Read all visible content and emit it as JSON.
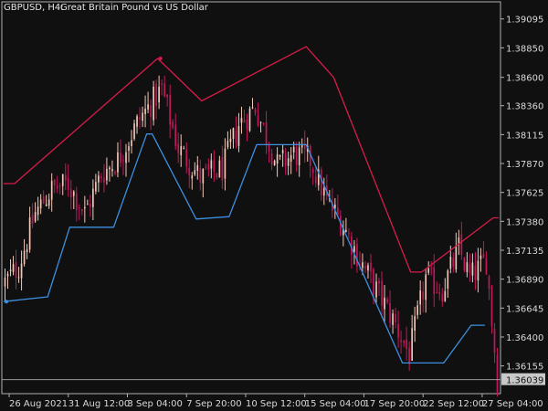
{
  "header": {
    "symbol_timeframe": "GBPUSD, H4:",
    "description": "Great Britain Pound vs US Dollar"
  },
  "colors": {
    "background": "#101010",
    "bull_candle": "#f2c7b8",
    "bear_candle": "#c2185b",
    "support_line": "#3d8fe0",
    "resistance_line": "#d81b4a",
    "axis_text": "#d8d8d8",
    "frame": "#b0b0b0",
    "current_price_box": "#c8c8c8"
  },
  "price_axis": {
    "labels": [
      "1.39095",
      "1.38850",
      "1.38600",
      "1.38360",
      "1.38115",
      "1.37870",
      "1.37625",
      "1.37380",
      "1.37135",
      "1.36890",
      "1.36645",
      "1.36400",
      "1.36155"
    ],
    "current_price": "1.36039"
  },
  "time_axis": {
    "labels": [
      "26 Aug 2021",
      "31 Aug 12:00",
      "3 Sep 04:00",
      "7 Sep 20:00",
      "10 Sep 12:00",
      "15 Sep 04:00",
      "17 Sep 20:00",
      "22 Sep 12:00",
      "27 Sep 04:00"
    ]
  },
  "chart_data": {
    "type": "candlestick",
    "symbol": "GBPUSD",
    "timeframe": "H4",
    "ylim": [
      1.3592,
      1.3924
    ],
    "bars": 180,
    "candle_path": [
      [
        0,
        1.3684
      ],
      [
        6,
        1.37
      ],
      [
        12,
        1.3745
      ],
      [
        18,
        1.3765
      ],
      [
        24,
        1.377
      ],
      [
        30,
        1.3745
      ],
      [
        36,
        1.3778
      ],
      [
        42,
        1.379
      ],
      [
        50,
        1.3825
      ],
      [
        58,
        1.385
      ],
      [
        64,
        1.38
      ],
      [
        72,
        1.3775
      ],
      [
        80,
        1.3782
      ],
      [
        86,
        1.382
      ],
      [
        92,
        1.3835
      ],
      [
        100,
        1.3785
      ],
      [
        106,
        1.3795
      ],
      [
        112,
        1.379
      ],
      [
        118,
        1.3755
      ],
      [
        124,
        1.3735
      ],
      [
        130,
        1.3705
      ],
      [
        136,
        1.368
      ],
      [
        142,
        1.3655
      ],
      [
        148,
        1.3625
      ],
      [
        154,
        1.369
      ],
      [
        160,
        1.368
      ],
      [
        166,
        1.3715
      ],
      [
        170,
        1.369
      ],
      [
        176,
        1.3705
      ],
      [
        180,
        1.3604
      ]
    ],
    "candle_path_units": "bar index, price",
    "support_line": {
      "points": [
        [
          0,
          1.367
        ],
        [
          16,
          1.3674
        ],
        [
          24,
          1.3733
        ],
        [
          40,
          1.3733
        ],
        [
          52,
          1.3812
        ],
        [
          54,
          1.3812
        ],
        [
          70,
          1.374
        ],
        [
          82,
          1.3742
        ],
        [
          92,
          1.3803
        ],
        [
          110,
          1.3803
        ],
        [
          145,
          1.3618
        ],
        [
          160,
          1.3618
        ],
        [
          170,
          1.365
        ],
        [
          175,
          1.365
        ]
      ],
      "start_dot": [
        1,
        1.367
      ]
    },
    "resistance_line": {
      "points": [
        [
          0,
          1.377
        ],
        [
          4,
          1.377
        ],
        [
          56,
          1.3876
        ],
        [
          72,
          1.384
        ],
        [
          110,
          1.3886
        ],
        [
          120,
          1.386
        ],
        [
          148,
          1.3695
        ],
        [
          152,
          1.3695
        ],
        [
          178,
          1.3741
        ],
        [
          180,
          1.3741
        ]
      ],
      "start_dot": [
        57,
        1.3876
      ]
    }
  }
}
